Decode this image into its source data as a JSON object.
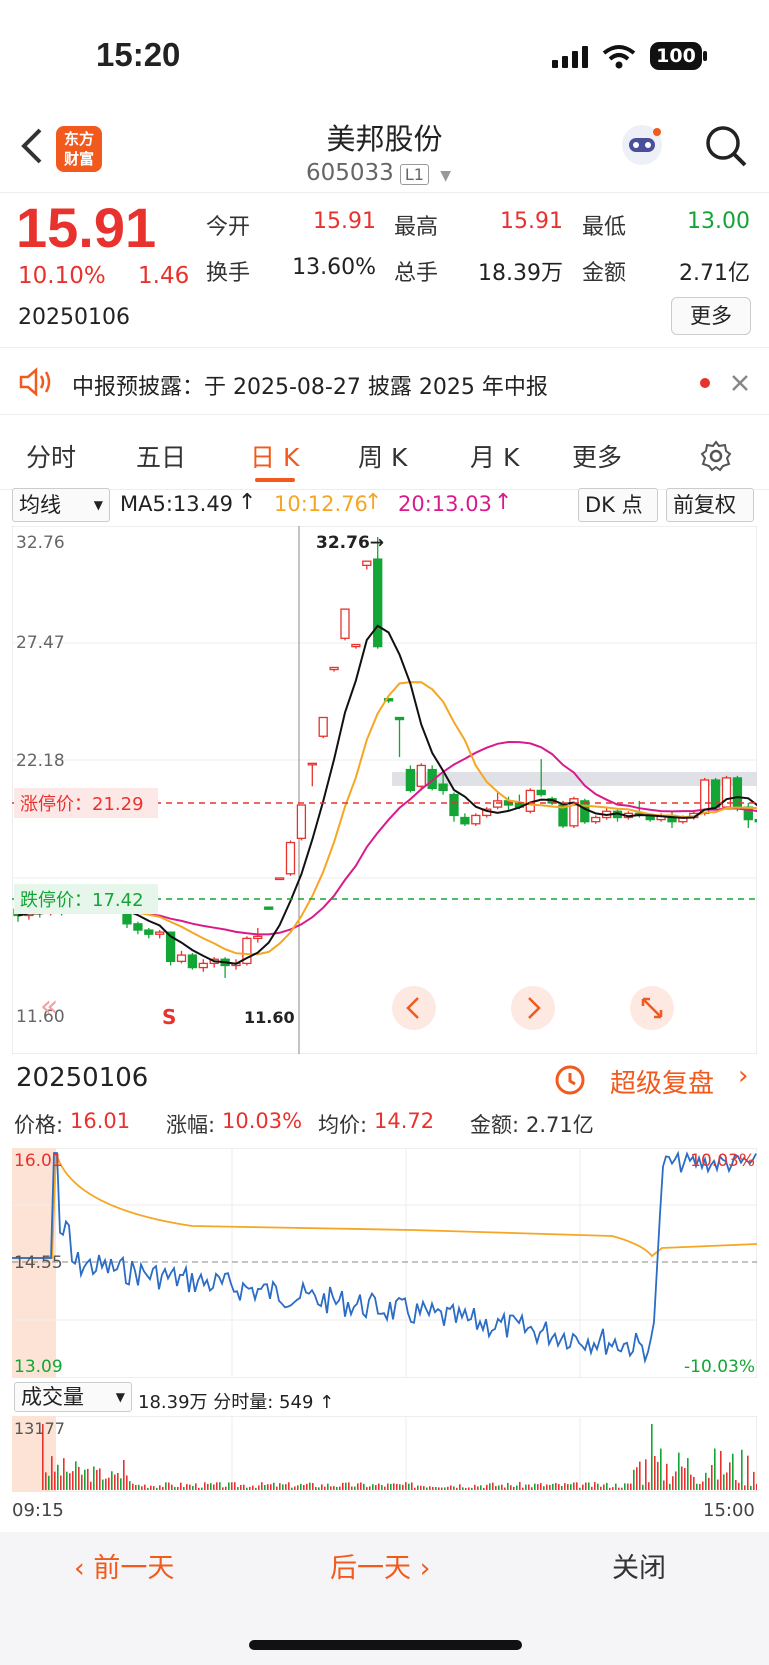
{
  "status": {
    "time": "15:20",
    "battery": "100"
  },
  "header": {
    "title": "美邦股份",
    "code": "605033",
    "market_tag": "L1",
    "logo_line1": "东方",
    "logo_line2": "财富"
  },
  "quote": {
    "price": "15.91",
    "change_pct": "10.10%",
    "change": "1.46",
    "date": "20250106",
    "open_label": "今开",
    "open": "15.91",
    "high_label": "最高",
    "high": "15.91",
    "low_label": "最低",
    "low": "13.00",
    "turnover_label": "换手",
    "turnover": "13.60%",
    "volume_label": "总手",
    "volume": "18.39万",
    "amount_label": "金额",
    "amount": "2.71亿",
    "more_label": "更多"
  },
  "notice": {
    "text": "中报预披露：于 2025-08-27 披露 2025 年中报"
  },
  "tabs": [
    "分时",
    "五日",
    "日 K",
    "周 K",
    "月 K",
    "更多"
  ],
  "active_tab": 2,
  "ma_bar": {
    "selector": "均线",
    "ma5": "MA5:13.49",
    "ma10": "10:12.76",
    "ma20": "20:13.03",
    "dk": "DK 点",
    "adjust": "前复权"
  },
  "kchart": {
    "y_labels": [
      "32.76",
      "27.47",
      "22.18",
      "11.60"
    ],
    "max_label": "32.76→",
    "min_label": "11.60",
    "limit_up_label": "涨停价：21.29",
    "limit_down_label": "跌停价：17.42",
    "buy_signal": "S",
    "colors": {
      "up": "#e8322d",
      "down": "#13a535",
      "ma5": "#111111",
      "ma10": "#f5a623",
      "ma20": "#d81b8c"
    },
    "candles": [
      {
        "o": 14.9,
        "c": 14.6,
        "h": 15.4,
        "l": 14.3
      },
      {
        "o": 14.6,
        "c": 14.8,
        "h": 14.9,
        "l": 14.4
      },
      {
        "o": 14.8,
        "c": 14.7,
        "h": 14.9,
        "l": 14.5
      },
      {
        "o": 14.7,
        "c": 14.9,
        "h": 15.0,
        "l": 14.6
      },
      {
        "o": 14.9,
        "c": 14.8,
        "h": 15.0,
        "l": 14.6
      },
      {
        "o": 14.8,
        "c": 15.0,
        "h": 15.1,
        "l": 14.7
      },
      {
        "o": 15.0,
        "c": 14.9,
        "h": 15.2,
        "l": 14.8
      },
      {
        "o": 14.9,
        "c": 15.1,
        "h": 15.2,
        "l": 14.8
      },
      {
        "o": 15.1,
        "c": 14.9,
        "h": 15.2,
        "l": 14.8
      },
      {
        "o": 14.9,
        "c": 15.0,
        "h": 15.1,
        "l": 14.8
      },
      {
        "o": 15.0,
        "c": 14.2,
        "h": 15.0,
        "l": 14.0
      },
      {
        "o": 14.2,
        "c": 13.9,
        "h": 14.3,
        "l": 13.7
      },
      {
        "o": 13.9,
        "c": 13.7,
        "h": 14.0,
        "l": 13.5
      },
      {
        "o": 13.7,
        "c": 13.8,
        "h": 13.9,
        "l": 13.5
      },
      {
        "o": 13.8,
        "c": 12.4,
        "h": 13.8,
        "l": 12.2
      },
      {
        "o": 12.4,
        "c": 12.7,
        "h": 12.9,
        "l": 12.3
      },
      {
        "o": 12.7,
        "c": 12.1,
        "h": 12.8,
        "l": 12.0
      },
      {
        "o": 12.1,
        "c": 12.3,
        "h": 12.5,
        "l": 11.9
      },
      {
        "o": 12.3,
        "c": 12.5,
        "h": 12.6,
        "l": 12.1
      },
      {
        "o": 12.5,
        "c": 12.2,
        "h": 12.6,
        "l": 11.6
      },
      {
        "o": 12.2,
        "c": 12.3,
        "h": 12.5,
        "l": 12.0
      },
      {
        "o": 12.3,
        "c": 13.5,
        "h": 13.6,
        "l": 12.2
      },
      {
        "o": 13.5,
        "c": 13.6,
        "h": 14.0,
        "l": 13.3
      },
      {
        "o": 15.0,
        "c": 14.9,
        "h": 15.0,
        "l": 14.9
      },
      {
        "o": 16.4,
        "c": 16.4,
        "h": 16.4,
        "l": 16.4
      },
      {
        "o": 16.6,
        "c": 18.1,
        "h": 18.2,
        "l": 16.5
      },
      {
        "o": 18.3,
        "c": 19.9,
        "h": 19.9,
        "l": 18.2
      },
      {
        "o": 21.9,
        "c": 21.9,
        "h": 21.9,
        "l": 20.8
      },
      {
        "o": 23.2,
        "c": 24.1,
        "h": 24.1,
        "l": 23.1
      },
      {
        "o": 26.4,
        "c": 26.5,
        "h": 26.5,
        "l": 26.3
      },
      {
        "o": 27.9,
        "c": 29.3,
        "h": 29.3,
        "l": 27.8
      },
      {
        "o": 27.5,
        "c": 27.6,
        "h": 27.6,
        "l": 27.4
      },
      {
        "o": 31.4,
        "c": 31.6,
        "h": 31.6,
        "l": 31.2
      },
      {
        "o": 31.7,
        "c": 27.5,
        "h": 32.76,
        "l": 27.4
      },
      {
        "o": 25.0,
        "c": 24.9,
        "h": 25.0,
        "l": 24.8
      },
      {
        "o": 24.1,
        "c": 24.0,
        "h": 24.1,
        "l": 22.2
      },
      {
        "o": 21.6,
        "c": 20.6,
        "h": 21.8,
        "l": 20.5
      },
      {
        "o": 20.8,
        "c": 21.8,
        "h": 21.9,
        "l": 20.6
      },
      {
        "o": 21.6,
        "c": 20.7,
        "h": 21.8,
        "l": 20.6
      },
      {
        "o": 20.9,
        "c": 20.6,
        "h": 21.4,
        "l": 20.4
      },
      {
        "o": 20.4,
        "c": 19.4,
        "h": 20.5,
        "l": 19.1
      },
      {
        "o": 19.3,
        "c": 19.0,
        "h": 19.5,
        "l": 18.9
      },
      {
        "o": 19.0,
        "c": 19.4,
        "h": 19.5,
        "l": 18.9
      },
      {
        "o": 19.4,
        "c": 19.7,
        "h": 19.8,
        "l": 19.3
      },
      {
        "o": 19.8,
        "c": 20.1,
        "h": 20.5,
        "l": 19.7
      },
      {
        "o": 20.1,
        "c": 19.9,
        "h": 20.3,
        "l": 19.6
      },
      {
        "o": 20.0,
        "c": 19.8,
        "h": 20.4,
        "l": 19.7
      },
      {
        "o": 19.6,
        "c": 20.6,
        "h": 20.7,
        "l": 19.5
      },
      {
        "o": 20.6,
        "c": 20.4,
        "h": 22.1,
        "l": 20.3
      },
      {
        "o": 20.2,
        "c": 20.0,
        "h": 20.3,
        "l": 19.9
      },
      {
        "o": 19.9,
        "c": 18.9,
        "h": 20.1,
        "l": 18.8
      },
      {
        "o": 18.9,
        "c": 20.2,
        "h": 20.3,
        "l": 18.8
      },
      {
        "o": 20.1,
        "c": 19.1,
        "h": 20.2,
        "l": 19.0
      },
      {
        "o": 19.1,
        "c": 19.3,
        "h": 19.4,
        "l": 19.0
      },
      {
        "o": 19.3,
        "c": 19.6,
        "h": 19.8,
        "l": 19.2
      },
      {
        "o": 19.6,
        "c": 19.3,
        "h": 19.7,
        "l": 19.1
      },
      {
        "o": 19.3,
        "c": 19.5,
        "h": 19.6,
        "l": 19.2
      },
      {
        "o": 19.5,
        "c": 19.4,
        "h": 20.1,
        "l": 19.3
      },
      {
        "o": 19.4,
        "c": 19.2,
        "h": 19.5,
        "l": 19.1
      },
      {
        "o": 19.2,
        "c": 19.4,
        "h": 19.5,
        "l": 19.1
      },
      {
        "o": 19.4,
        "c": 19.1,
        "h": 19.6,
        "l": 18.8
      },
      {
        "o": 19.1,
        "c": 19.3,
        "h": 19.4,
        "l": 19.0
      },
      {
        "o": 19.3,
        "c": 19.5,
        "h": 19.6,
        "l": 19.2
      },
      {
        "o": 19.5,
        "c": 21.1,
        "h": 21.2,
        "l": 19.4
      },
      {
        "o": 21.1,
        "c": 19.8,
        "h": 21.2,
        "l": 19.7
      },
      {
        "o": 19.8,
        "c": 21.2,
        "h": 21.3,
        "l": 19.7
      },
      {
        "o": 21.2,
        "c": 19.8,
        "h": 21.3,
        "l": 19.6
      },
      {
        "o": 19.8,
        "c": 19.2,
        "h": 20.0,
        "l": 18.8
      },
      {
        "o": 19.2,
        "c": 19.1,
        "h": 19.3,
        "l": 19.0
      },
      {
        "o": 19.1,
        "c": 18.8,
        "h": 19.2,
        "l": 18.7
      }
    ]
  },
  "date_bar": {
    "date": "20250106",
    "replay": "超级复盘"
  },
  "info_bar": {
    "price_label": "价格:",
    "price": "16.01",
    "chg_label": "涨幅:",
    "chg": "10.03%",
    "avg_label": "均价:",
    "avg": "14.72",
    "amt_label": "金额:",
    "amt": "2.71亿"
  },
  "time_chart": {
    "top": "16.01",
    "mid": "14.55",
    "bottom": "13.09",
    "top_pct": "10.03%",
    "bottom_pct": "-10.03%"
  },
  "volume_bar": {
    "selector": "成交量",
    "text": "18.39万 分时量: 549 ↑"
  },
  "volume_chart": {
    "max": "13177",
    "start": "09:15",
    "end": "15:00"
  },
  "bottom_nav": {
    "prev": "前一天",
    "next": "后一天",
    "close": "关闭"
  }
}
